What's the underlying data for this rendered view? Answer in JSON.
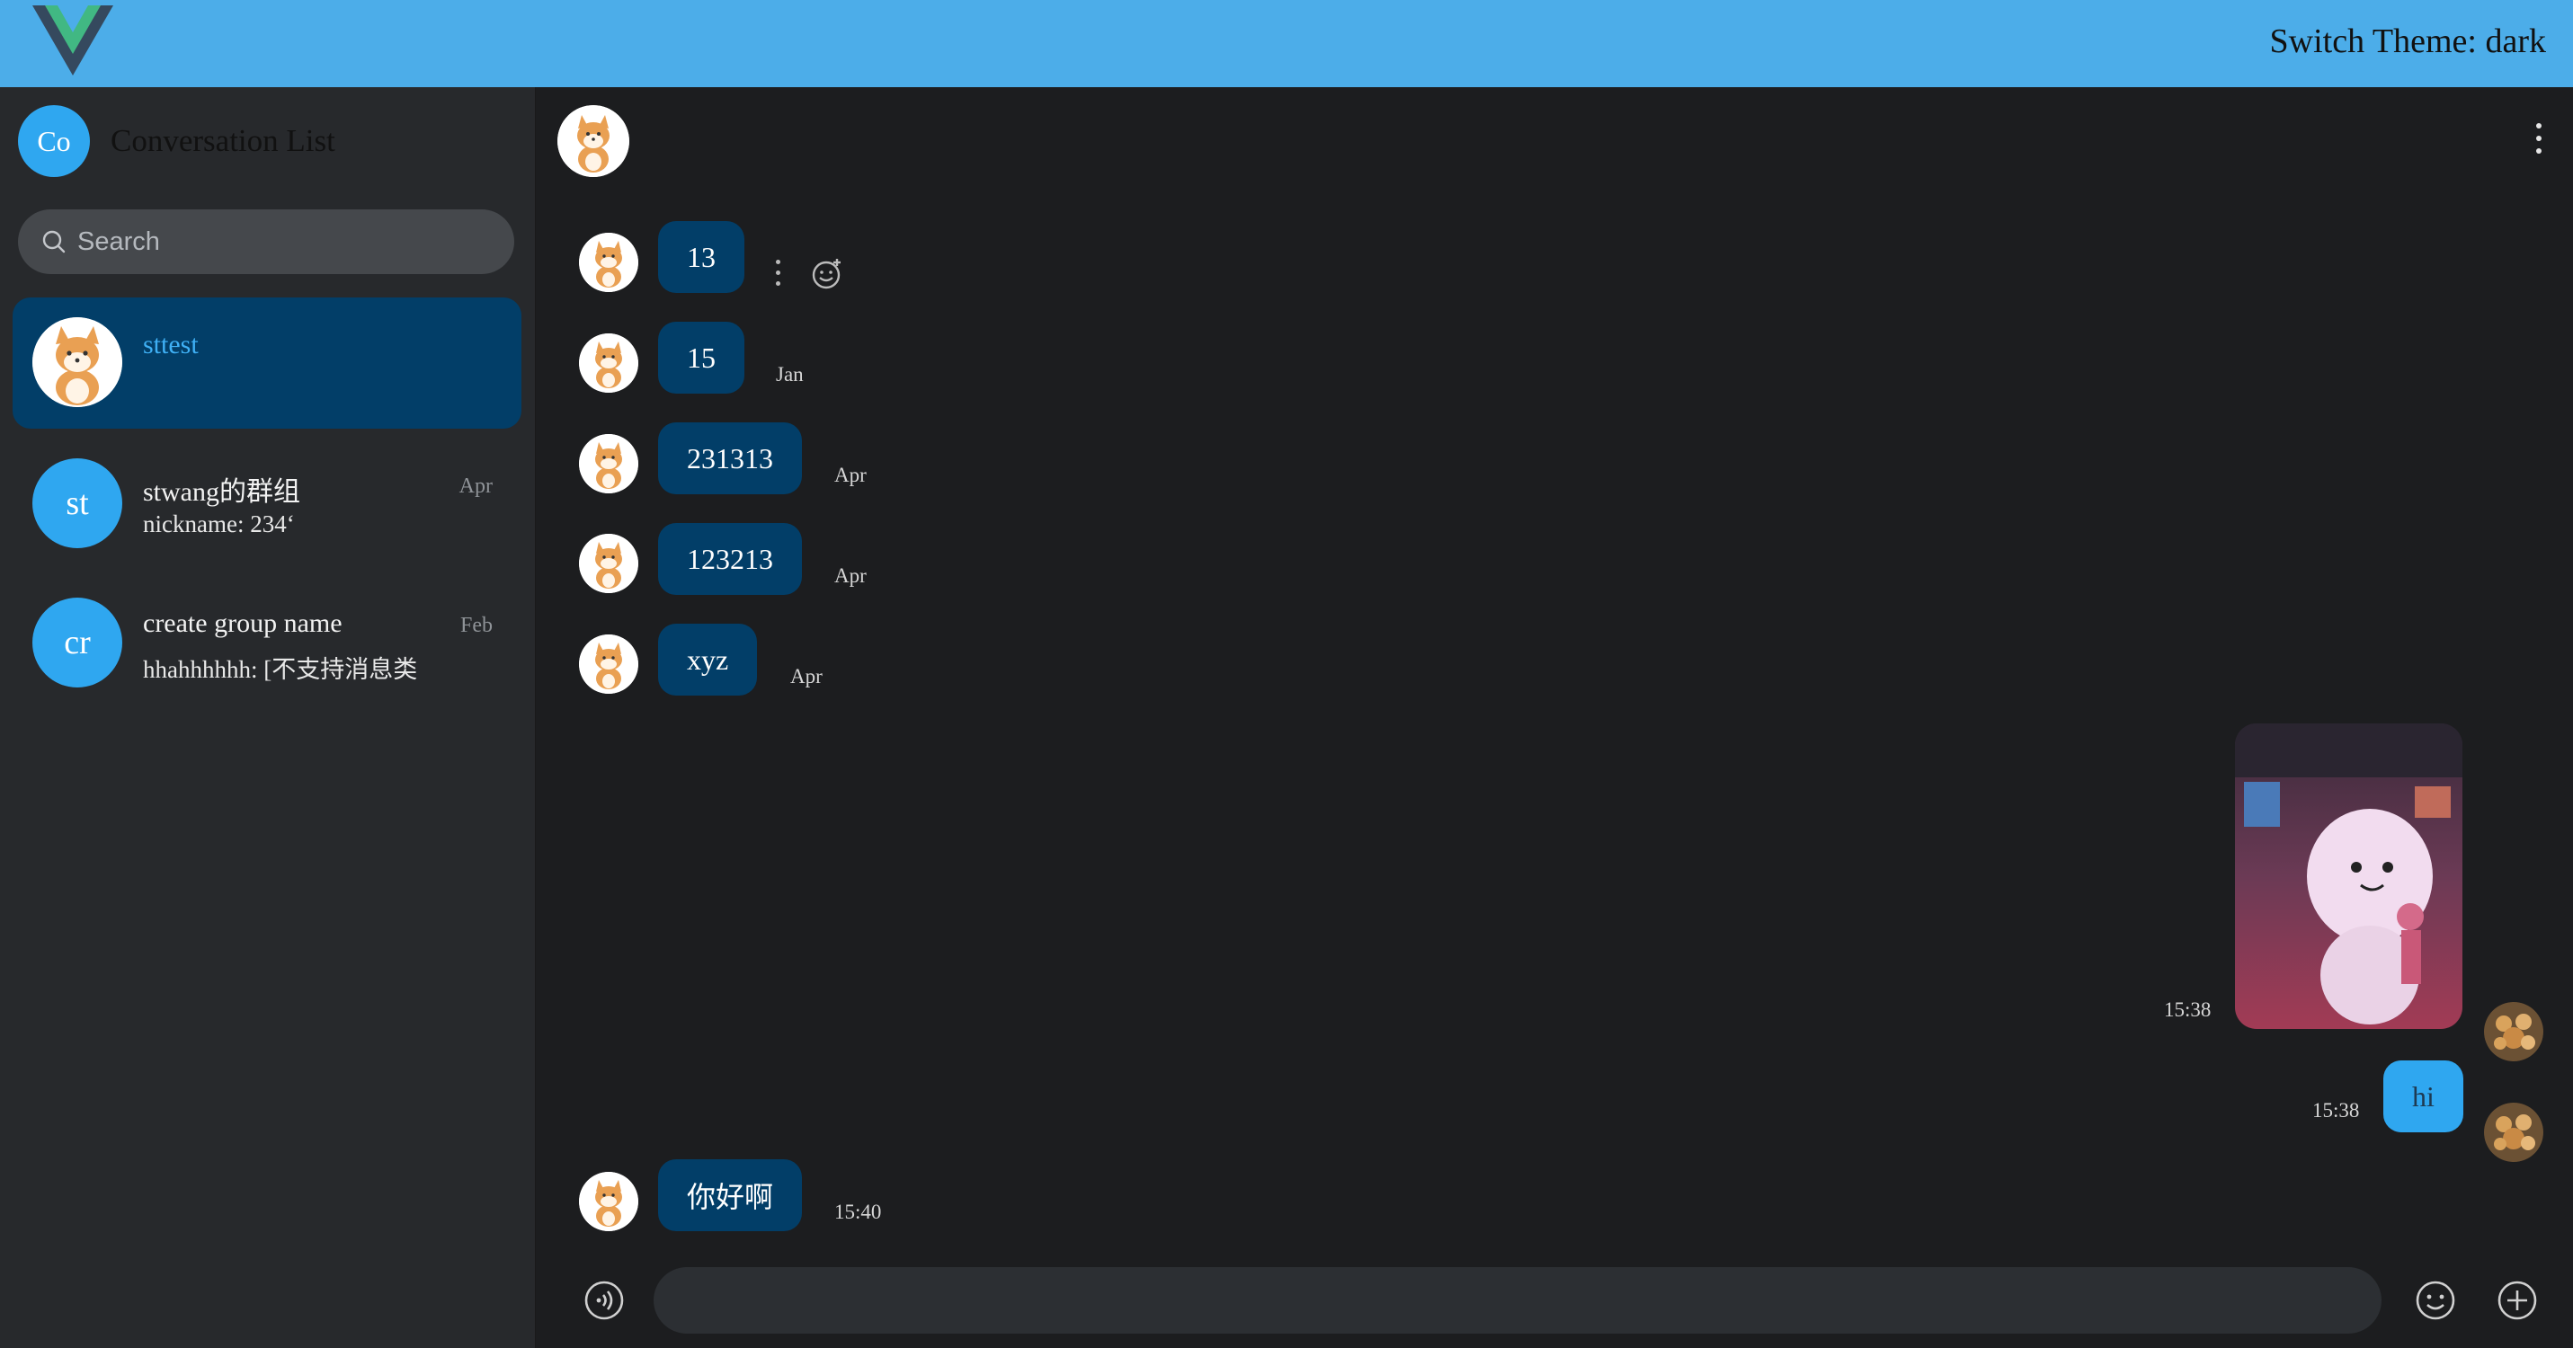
{
  "header": {
    "theme_switch_label": "Switch Theme: dark",
    "brand_color": "#4cade9"
  },
  "sidebar": {
    "avatar_initials": "Co",
    "title": "Conversation List",
    "search_placeholder": "Search",
    "conversations": [
      {
        "name": "sttest",
        "preview": "",
        "time": "",
        "active": true,
        "avatar": "shiba-dog-avatar"
      },
      {
        "name": "stwang的群组",
        "preview": "nickname: 234‘",
        "time": "Apr",
        "initials": "st"
      },
      {
        "name": "create group name",
        "preview": "hhahhhhhh: [不支持消息类",
        "time": "Feb",
        "initials": "cr"
      }
    ]
  },
  "chat": {
    "messages": [
      {
        "text": "13",
        "time": "",
        "from": "other"
      },
      {
        "text": "15",
        "time": "Jan",
        "from": "other"
      },
      {
        "text": "231313",
        "time": "Apr",
        "from": "other"
      },
      {
        "text": "123213",
        "time": "Apr",
        "from": "other"
      },
      {
        "text": "xyz",
        "time": "Apr",
        "from": "other"
      },
      {
        "type": "image",
        "time": "15:38",
        "from": "me"
      },
      {
        "text": "hi",
        "time": "15:38",
        "from": "me"
      },
      {
        "text": "你好啊",
        "time": "15:40",
        "from": "other"
      }
    ],
    "input_placeholder": "",
    "colors": {
      "bubble_other": "#023e68",
      "bubble_mine": "#2fa7f0",
      "background": "#1c1d1f"
    }
  }
}
